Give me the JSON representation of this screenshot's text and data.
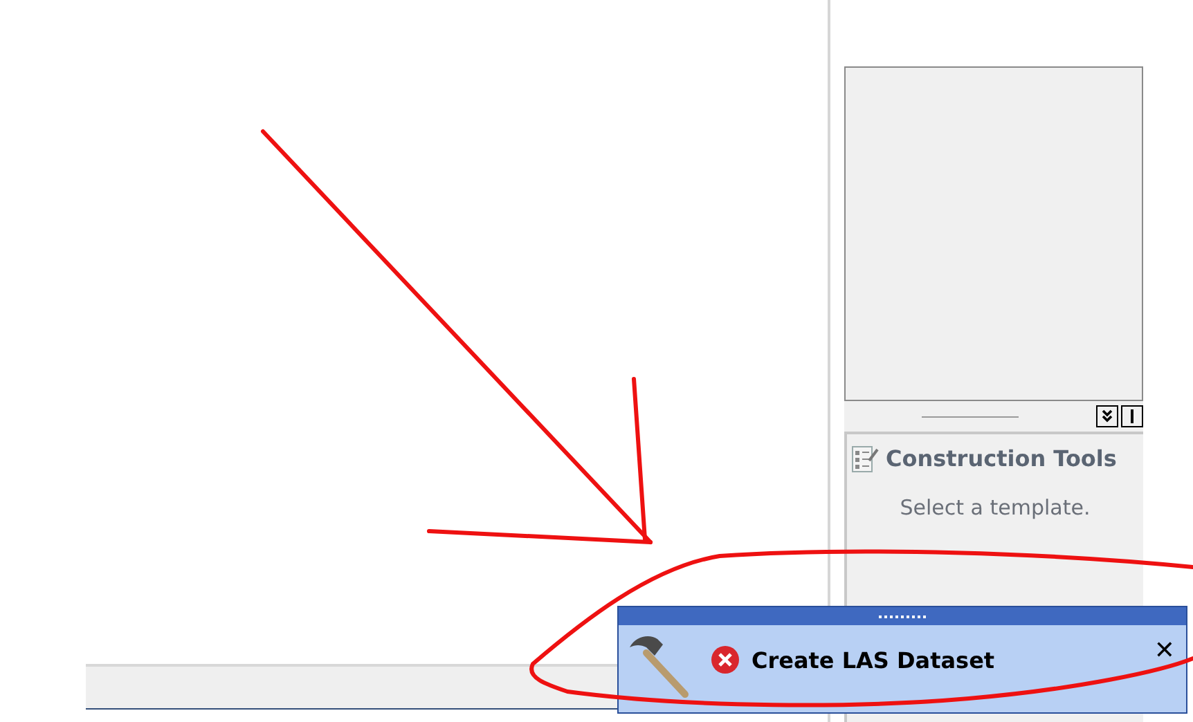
{
  "construction_tools": {
    "title": "Construction Tools",
    "message": "Select a template."
  },
  "notification": {
    "error": true,
    "title": "Create LAS Dataset",
    "close": "✕"
  }
}
